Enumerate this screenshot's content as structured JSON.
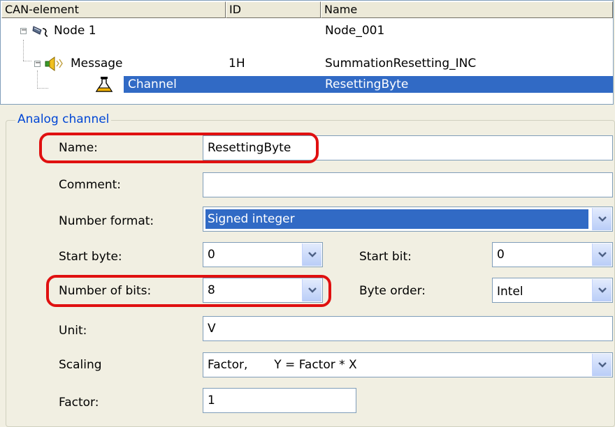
{
  "tree": {
    "columns": [
      "CAN-element",
      "ID",
      "Name"
    ],
    "rows": [
      {
        "label": "Node 1",
        "id": "",
        "name": "Node_001",
        "expander": "−",
        "icon": "node-icon"
      },
      {
        "label": "Message",
        "id": "1H",
        "name": "SummationResetting_INC",
        "expander": "−",
        "icon": "message-icon"
      },
      {
        "label": "Channel",
        "id": "",
        "name": "ResettingByte",
        "icon": "flask-icon",
        "selected": true
      }
    ]
  },
  "form": {
    "group_title": "Analog channel",
    "name_label": "Name:",
    "name_value": "ResettingByte",
    "comment_label": "Comment:",
    "comment_value": "",
    "number_format_label": "Number format:",
    "number_format_value": "Signed integer",
    "start_byte_label": "Start byte:",
    "start_byte_value": "0",
    "start_bit_label": "Start bit:",
    "start_bit_value": "0",
    "bits_label": "Number of bits:",
    "bits_value": "8",
    "byte_order_label": "Byte order:",
    "byte_order_value": "Intel",
    "unit_label": "Unit:",
    "unit_value": "V",
    "scaling_label": "Scaling",
    "scaling_value": "Factor,       Y = Factor * X",
    "factor_label": "Factor:",
    "factor_value": "1"
  },
  "colors": {
    "selection": "#316ac5",
    "annotation": "#e01010",
    "group_title": "#0046d5"
  }
}
